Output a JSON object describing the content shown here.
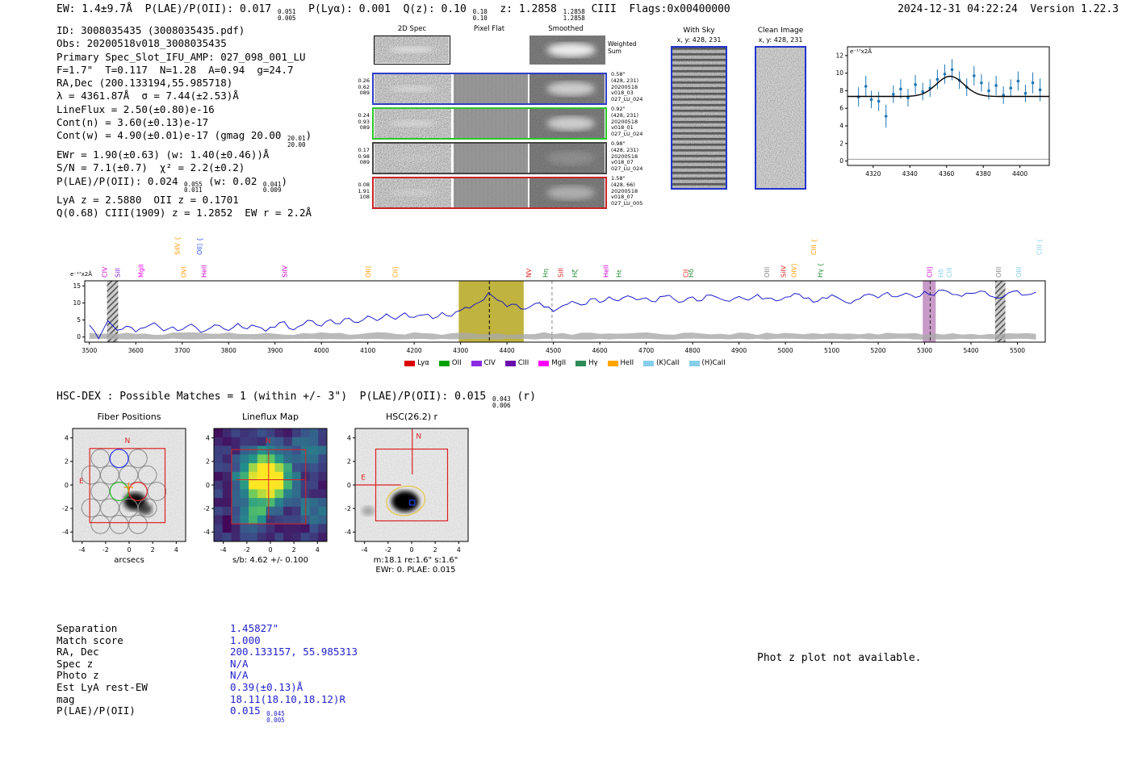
{
  "header": {
    "left": [
      {
        "t": "EW: 1.4±9.7Å  P(LAE)/P(OII): 0.017 "
      },
      {
        "hi": "0.051",
        "lo": "0.005"
      },
      {
        "t": "  P(Lyα): 0.001  Q(z): 0.10 "
      },
      {
        "hi": "0.10",
        "lo": "0.10"
      },
      {
        "t": "  z: 1.2858 "
      },
      {
        "hi": "1.2858",
        "lo": "1.2858"
      },
      {
        "t": " CIII  Flags:0x00400000"
      }
    ],
    "right": "2024-12-31 04:22:24  Version 1.22.3"
  },
  "info_block": [
    [
      {
        "t": "ID: 3008035435 (3008035435.pdf)"
      }
    ],
    [
      {
        "t": "Obs: 20200518v018_3008035435"
      }
    ],
    [
      {
        "t": "Primary Spec_Slot_IFU_AMP: 027_098_001_LU"
      }
    ],
    [
      {
        "t": "F=1.7\"  T=0.117  N=1.28  A=0.94  g=24.7"
      }
    ],
    [
      {
        "t": "RA,Dec (200.133194,55.985718)"
      }
    ],
    [
      {
        "t": "λ = 4361.87Å  σ = 7.44(±2.53)Å"
      }
    ],
    [
      {
        "t": "LineFlux = 2.50(±0.80)e-16"
      }
    ],
    [
      {
        "t": "Cont(n) = 3.60(±0.13)e-17"
      }
    ],
    [
      {
        "t": "Cont(w) = 4.90(±0.01)e-17 (gmag 20.00 "
      },
      {
        "hi": "20.01",
        "lo": "20.00"
      },
      {
        "t": ")"
      }
    ],
    [
      {
        "t": "EWr = 1.90(±0.63) (w: 1.40(±0.46))Å"
      }
    ],
    [
      {
        "t": "S/N = 7.1(±0.7)  χ² = 2.2(±0.2)"
      }
    ],
    [
      {
        "t": "P(LAE)/P(OII): 0.024 "
      },
      {
        "hi": "0.055",
        "lo": "0.011"
      },
      {
        "t": " (w: 0.02 "
      },
      {
        "hi": "0.041",
        "lo": "0.009"
      },
      {
        "t": ")"
      }
    ],
    [
      {
        "t": "LyA z = 2.5880  OII z = 0.1701"
      }
    ],
    [
      {
        "t": "Q(0.68) CIII(1909) z = 1.2852  EW r = 2.2Å"
      }
    ]
  ],
  "spec2d": {
    "col_headers": [
      "2D Spec",
      "Pixel Flat",
      "Smoothed"
    ],
    "weighted_sum": [
      "Weighted",
      "Sum"
    ],
    "rows": [
      {
        "border": "#000000",
        "left": [],
        "right": []
      },
      {
        "border": "#2e3cc8",
        "left": [
          "0.26",
          "0.62",
          "089"
        ],
        "right": [
          "0.58\"",
          "(428, 231)",
          "20200518",
          "v018_03",
          "027_LU_024"
        ]
      },
      {
        "border": "#2bc82b",
        "left": [
          "0.24",
          "0.93",
          "089"
        ],
        "right": [
          "0.92\"",
          "(428, 231)",
          "20200518",
          "v018_01",
          "027_LU_024"
        ]
      },
      {
        "border": "#444444",
        "left": [
          "0.17",
          "0.98",
          "089"
        ],
        "right": [
          "0.98\"",
          "(428, 231)",
          "20200518",
          "v018_07",
          "027_LU_024"
        ]
      },
      {
        "border": "#cc2222",
        "left": [
          "0.08",
          "1.91",
          "108"
        ],
        "right": [
          "1.58\"",
          "(428, 66)",
          "20200518",
          "v018_07",
          "027_LU_005"
        ]
      }
    ]
  },
  "withsky": {
    "title": "With Sky",
    "coords": "x, y: 428, 231"
  },
  "cleanimage": {
    "title": "Clean Image",
    "coords": "x, y: 428, 231"
  },
  "legend": [
    {
      "label": "Lyα",
      "color": "#dd0000"
    },
    {
      "label": "OII",
      "color": "#00a000"
    },
    {
      "label": "CIV",
      "color": "#8a2be2"
    },
    {
      "label": "CIII",
      "color": "#6a0dad"
    },
    {
      "label": "MgII",
      "color": "#ff00ff"
    },
    {
      "label": "Hγ",
      "color": "#2e8b57"
    },
    {
      "label": "HeII",
      "color": "#ffa500"
    },
    {
      "label": "(K)CaII",
      "color": "#87ceeb"
    },
    {
      "label": "(H)CaII",
      "color": "#87ceeb"
    }
  ],
  "hscdex": [
    {
      "t": "HSC-DEX : Possible Matches = 1 (within +/- 3\")  P(LAE)/P(OII): 0.015 "
    },
    {
      "hi": "0.043",
      "lo": "0.006"
    },
    {
      "t": " (r)"
    }
  ],
  "cutouts": {
    "fibers": {
      "title": "Fiber Positions",
      "xlabel": "arcsecs",
      "compass_n": "N",
      "compass_e": "E",
      "ticks": [
        -4,
        -2,
        0,
        2,
        4
      ]
    },
    "lineflux": {
      "title": "Lineflux Map",
      "xlabel": "s/b: 4.62 +/- 0.100",
      "compass_n": "N",
      "ticks": [
        -4,
        -2,
        0,
        2,
        4
      ]
    },
    "hsc": {
      "title": "HSC(26.2) r",
      "xlabel1": "m:18.1 re:1.6\" s:1.6\"",
      "xlabel2": "EWr: 0. PLAE: 0.015",
      "compass_n": "N",
      "compass_e": "E",
      "ticks": [
        -4,
        -2,
        0,
        2,
        4
      ]
    }
  },
  "match_table": {
    "rows": [
      {
        "label": "Separation",
        "value": [
          {
            "t": "1.45827\""
          }
        ]
      },
      {
        "label": "Match score",
        "value": [
          {
            "t": "1.000"
          }
        ]
      },
      {
        "label": "RA, Dec",
        "value": [
          {
            "t": "200.133157, 55.985313"
          }
        ]
      },
      {
        "label": "Spec z",
        "value": [
          {
            "t": "N/A"
          }
        ]
      },
      {
        "label": "Photo z",
        "value": [
          {
            "t": "N/A"
          }
        ]
      },
      {
        "label": "Est LyA rest-EW",
        "value": [
          {
            "t": "0.39(±0.13)Å"
          }
        ]
      },
      {
        "label": "mag",
        "value": [
          {
            "t": "18.11(18.10,18.12)R"
          }
        ]
      },
      {
        "label": "P(LAE)/P(OII)",
        "value": [
          {
            "t": "0.015 "
          },
          {
            "hi": "0.045",
            "lo": "0.005"
          }
        ]
      }
    ]
  },
  "photz_note": "Phot z plot not available.",
  "chart_data": [
    {
      "id": "full-spectrum",
      "type": "line",
      "ylabel": "e⁻¹⁷x2Å",
      "xlim": [
        3490,
        5560
      ],
      "ylim": [
        -1.5,
        16.5
      ],
      "xticks": [
        3500,
        3600,
        3700,
        3800,
        3900,
        4000,
        4100,
        4200,
        4300,
        4400,
        4500,
        4600,
        4700,
        4800,
        4900,
        5000,
        5100,
        5200,
        5300,
        5400,
        5500
      ],
      "yticks": [
        0,
        5,
        10,
        15
      ],
      "x_start": 3500,
      "x_step": 20,
      "flux": [
        3.5,
        -0.5,
        4.8,
        2.0,
        3.2,
        1.5,
        2.8,
        4.2,
        1.8,
        3.0,
        2.2,
        3.8,
        1.4,
        2.6,
        3.4,
        1.9,
        4.0,
        2.4,
        3.1,
        1.7,
        2.9,
        4.5,
        2.1,
        3.6,
        4.8,
        3.2,
        5.1,
        3.9,
        5.5,
        4.3,
        6.2,
        4.8,
        6.8,
        5.2,
        7.1,
        5.8,
        6.5,
        5.4,
        7.2,
        6.1,
        7.8,
        8.5,
        10.2,
        13.0,
        10.8,
        8.9,
        9.6,
        8.2,
        9.8,
        8.8,
        7.5,
        9.2,
        10.5,
        9.4,
        11.2,
        10.1,
        11.8,
        10.6,
        12.1,
        10.9,
        11.5,
        10.3,
        12.0,
        11.1,
        10.4,
        11.8,
        10.7,
        12.3,
        11.2,
        10.5,
        11.9,
        10.8,
        12.5,
        11.4,
        10.6,
        11.7,
        12.8,
        11.3,
        10.2,
        11.6,
        12.4,
        11.0,
        9.8,
        11.2,
        12.6,
        11.5,
        13.1,
        11.8,
        12.9,
        11.6,
        13.4,
        12.2,
        13.8,
        12.5,
        11.9,
        12.8,
        13.5,
        12.1,
        11.4,
        12.9,
        13.6,
        12.4,
        13.2
      ],
      "noise_level": 1.2,
      "line_color": "#0808c8",
      "bands": [
        {
          "x0": 3538,
          "x1": 3562,
          "style": "hatch"
        },
        {
          "x0": 4296,
          "x1": 4436,
          "style": "fill",
          "color": "#b5a61d",
          "opacity": 0.85
        },
        {
          "x0": 5296,
          "x1": 5324,
          "style": "fill",
          "color": "#b06fb0",
          "opacity": 0.7
        },
        {
          "x0": 5452,
          "x1": 5474,
          "style": "hatch"
        }
      ],
      "vlines": [
        {
          "x": 4362,
          "color": "#000000"
        },
        {
          "x": 4497,
          "color": "#888888"
        },
        {
          "x": 5312,
          "color": "#222222"
        }
      ],
      "line_labels": [
        {
          "label": "CIV",
          "wl": 3538,
          "color": "#cc00cc"
        },
        {
          "label": "SiII",
          "wl": 3566,
          "color": "#8a2be2"
        },
        {
          "label": "MgII",
          "wl": 3616,
          "color": "#ff00ff"
        },
        {
          "label": "SiIV {",
          "wl": 3694,
          "color": "#ff9900",
          "tier": 2
        },
        {
          "label": "OVI",
          "wl": 3708,
          "color": "#ff9900"
        },
        {
          "label": "OII] {",
          "wl": 3742,
          "color": "#3355ff",
          "tier": 2
        },
        {
          "label": "HeII",
          "wl": 3752,
          "color": "#cc00cc"
        },
        {
          "label": "SiIV",
          "wl": 3926,
          "color": "#cc00cc"
        },
        {
          "label": "OII]",
          "wl": 4106,
          "color": "#ff9900"
        },
        {
          "label": "CII]",
          "wl": 4164,
          "color": "#ff9900"
        },
        {
          "label": "NV",
          "wl": 4452,
          "color": "#dd2222"
        },
        {
          "label": "Hη",
          "wl": 4488,
          "color": "#228833"
        },
        {
          "label": "SiII",
          "wl": 4521,
          "color": "#dd2222"
        },
        {
          "label": "Hζ",
          "wl": 4551,
          "color": "#228833"
        },
        {
          "label": "HeII",
          "wl": 4618,
          "color": "#cc00cc"
        },
        {
          "label": "Hε",
          "wl": 4646,
          "color": "#228833"
        },
        {
          "label": "CII",
          "wl": 4790,
          "color": "#dd2222"
        },
        {
          "label": "Hδ",
          "wl": 4802,
          "color": "#228833"
        },
        {
          "label": "OIII",
          "wl": 4965,
          "color": "#888888"
        },
        {
          "label": "SiIV",
          "wl": 5001,
          "color": "#dd2222"
        },
        {
          "label": "OIV]",
          "wl": 5023,
          "color": "#ff9900"
        },
        {
          "label": "CIII {",
          "wl": 5066,
          "color": "#ff9900",
          "tier": 2
        },
        {
          "label": "Hγ {",
          "wl": 5080,
          "color": "#228833"
        },
        {
          "label": "CII]",
          "wl": 5316,
          "color": "#cc00cc"
        },
        {
          "label": "Hδ",
          "wl": 5340,
          "color": "#87ceeb"
        },
        {
          "label": "CIII",
          "wl": 5358,
          "color": "#87ceeb"
        },
        {
          "label": "OIII",
          "wl": 5464,
          "color": "#888888"
        },
        {
          "label": "OIII",
          "wl": 5508,
          "color": "#87ceeb"
        },
        {
          "label": "CIII {",
          "wl": 5552,
          "color": "#87ceeb",
          "tier": 2
        }
      ]
    },
    {
      "id": "line-fit",
      "type": "scatter",
      "ylabel": "e⁻¹⁷x2Å",
      "xlim": [
        4306,
        4416
      ],
      "ylim": [
        -0.5,
        13
      ],
      "xticks": [
        4320,
        4340,
        4360,
        4380,
        4400
      ],
      "yticks": [
        0,
        2,
        4,
        6,
        8,
        10,
        12
      ],
      "point_color": "#1f77b4",
      "points": [
        [
          4312,
          7.3,
          1.1
        ],
        [
          4316,
          8.5,
          1.2
        ],
        [
          4319,
          7.0,
          1.0
        ],
        [
          4323,
          6.8,
          1.1
        ],
        [
          4327,
          5.1,
          1.3
        ],
        [
          4331,
          7.6,
          1.0
        ],
        [
          4335,
          8.2,
          1.1
        ],
        [
          4339,
          7.2,
          1.0
        ],
        [
          4343,
          8.7,
          1.1
        ],
        [
          4347,
          7.9,
          1.0
        ],
        [
          4351,
          8.3,
          1.0
        ],
        [
          4355,
          9.3,
          1.1
        ],
        [
          4359,
          9.9,
          1.1
        ],
        [
          4363,
          10.4,
          1.2
        ],
        [
          4367,
          9.2,
          1.0
        ],
        [
          4371,
          8.4,
          1.0
        ],
        [
          4375,
          9.7,
          1.1
        ],
        [
          4379,
          8.9,
          1.0
        ],
        [
          4383,
          8.0,
          1.0
        ],
        [
          4387,
          8.6,
          1.1
        ],
        [
          4391,
          7.5,
          1.0
        ],
        [
          4395,
          8.3,
          1.0
        ],
        [
          4399,
          9.1,
          1.1
        ],
        [
          4403,
          7.7,
          1.0
        ],
        [
          4407,
          8.9,
          1.2
        ],
        [
          4411,
          8.1,
          1.3
        ]
      ],
      "fit": {
        "base": 7.35,
        "amp": 2.3,
        "center": 4361.9,
        "sigma": 7.44,
        "color": "#000000"
      }
    }
  ]
}
